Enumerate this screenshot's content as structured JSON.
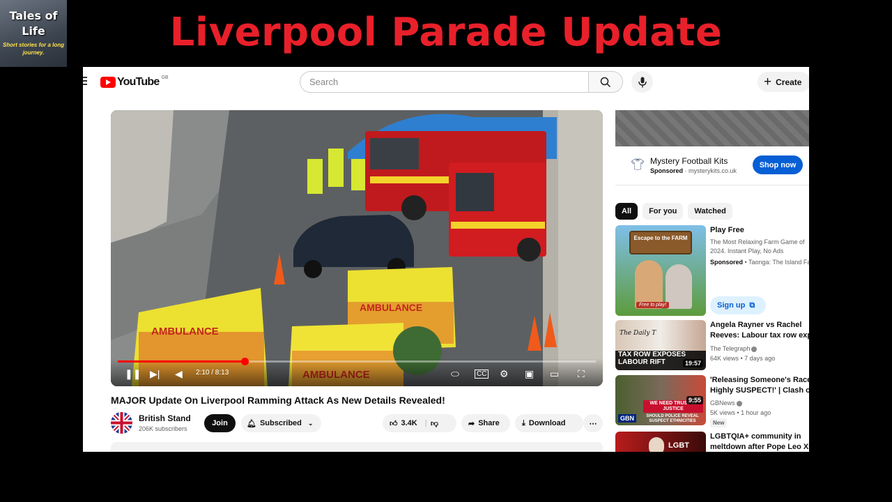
{
  "overlay": {
    "logo_title_line1": "Tales of",
    "logo_title_line2": "Life",
    "logo_subtitle": "Short stories for a long journey.",
    "headline": "Liverpool Parade Update",
    "headline_color": "#e8202a"
  },
  "header": {
    "brand": "YouTube",
    "region": "GB",
    "search_placeholder": "Search",
    "create_label": "Create"
  },
  "player": {
    "time": "2:10 / 8:13",
    "progress_fraction": 0.265,
    "accent": "#ff0000"
  },
  "video": {
    "title": "MAJOR Update On Liverpool Ramming Attack As New Details Revealed!",
    "channel": "British Stand",
    "subscribers": "206K subscribers",
    "join_label": "Join",
    "subscribed_label": "Subscribed",
    "likes": "3.4K",
    "share_label": "Share",
    "download_label": "Download"
  },
  "ad": {
    "title": "Mystery Football Kits",
    "sponsored": "Sponsored",
    "domain": "mysterykits.co.uk",
    "cta": "Shop now"
  },
  "chips": [
    "All",
    "For you",
    "Watched"
  ],
  "recs": [
    {
      "title": "Play Free",
      "desc1": "The Most Relaxing Farm Game of",
      "desc2": "2024. Instant Play, No Ads",
      "sponsored": "Sponsored",
      "advertiser": "Taonga: The Island Fa",
      "cta": "Sign up",
      "thumb_title": "Escape to the FARM",
      "thumb_badge": "Free to play!"
    },
    {
      "title1": "Angela Rayner vs Rachel",
      "title2": "Reeves: Labour tax row expos",
      "channel": "The Telegraph",
      "meta": "64K views • 7 days ago",
      "duration": "19:57",
      "thumb_brand": "The Daily T",
      "thumb_text": "TAX ROW EXPOSES LABOUR RIFT"
    },
    {
      "title1": "'Releasing Someone's Race is",
      "title2": "Highly SUSPECT!' | Clash on...",
      "channel": "GBNews",
      "meta": "5K views • 1 hour ago",
      "badge": "New",
      "duration": "9:55",
      "thumb_brand": "GBN",
      "thumb_text1": "WE NEED TRUST IN JUSTICE",
      "thumb_text2": "SHOULD POLICE REVEAL SUSPECT ETHNICITIES"
    },
    {
      "title1": "LGBTQIA+ community in",
      "title2": "meltdown after Pope Leo XIV",
      "thumb_text": "LGBT"
    }
  ]
}
